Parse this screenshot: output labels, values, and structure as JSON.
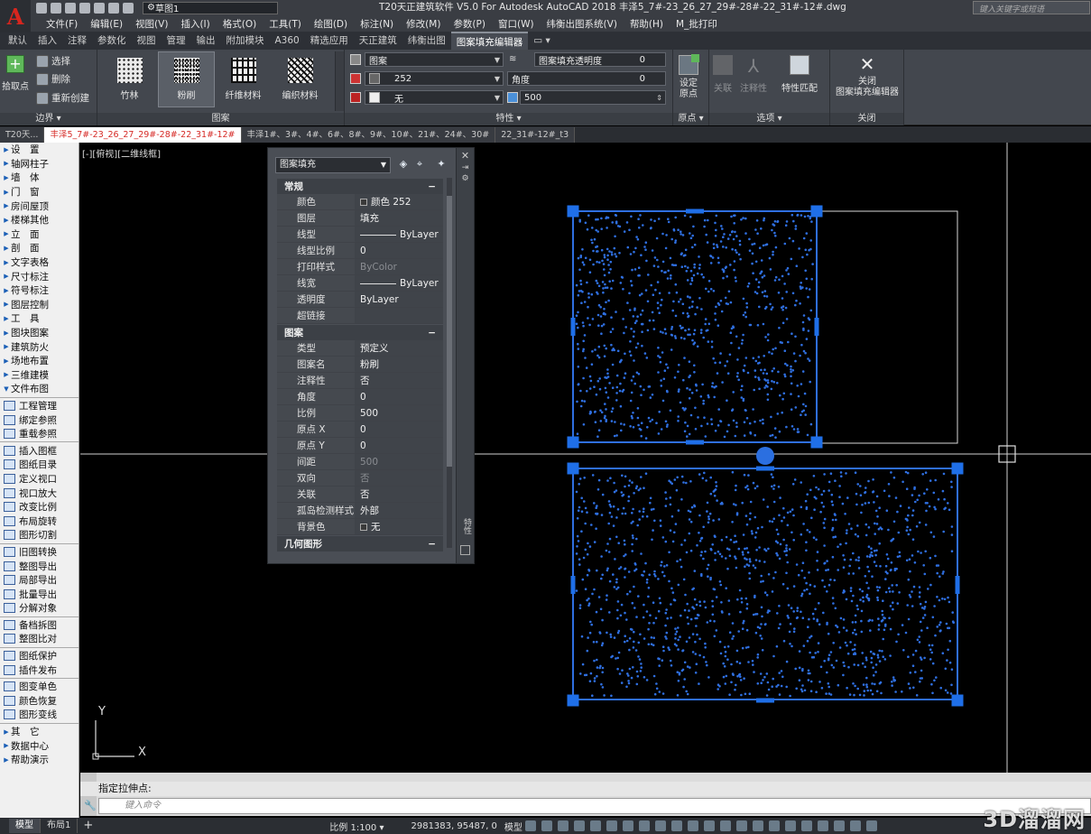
{
  "app": {
    "logo": "A",
    "title": "T20天正建筑软件 V5.0 For Autodesk AutoCAD 2018    丰泽5_7#-23_26_27_29#-28#-22_31#-12#.dwg",
    "workspace": "草图1",
    "search_placeholder": "键入关键字或短语"
  },
  "menubar": [
    "文件(F)",
    "编辑(E)",
    "视图(V)",
    "插入(I)",
    "格式(O)",
    "工具(T)",
    "绘图(D)",
    "标注(N)",
    "修改(M)",
    "参数(P)",
    "窗口(W)",
    "纬衡出图系统(V)",
    "帮助(H)",
    "M_批打印"
  ],
  "ribbon_tabs": [
    "默认",
    "插入",
    "注释",
    "参数化",
    "视图",
    "管理",
    "输出",
    "附加模块",
    "A360",
    "精选应用",
    "天正建筑",
    "纬衡出图",
    "图案填充编辑器"
  ],
  "ribbon_active_tab": "图案填充编辑器",
  "ribbon": {
    "boundary": {
      "pick_label": "拾取点",
      "select_label": "选择",
      "delete_label": "删除",
      "recreate_label": "重新创建",
      "title": "边界 ▾"
    },
    "pattern": {
      "items": [
        "竹林",
        "粉刷",
        "纤维材料",
        "编织材料"
      ],
      "selected": "粉刷",
      "title": "图案"
    },
    "properties": {
      "type": "图案",
      "transparency_label": "图案填充透明度",
      "transparency": "0",
      "color": "252",
      "angle_label": "角度",
      "angle": "0",
      "bg": "无",
      "scale": "500",
      "title": "特性 ▾"
    },
    "origin": {
      "set_label": "设定\n原点",
      "title": "原点 ▾"
    },
    "options": {
      "assoc": "关联",
      "annot": "注释性",
      "match": "特性匹配",
      "title": "选项 ▾"
    },
    "close": {
      "label": "关闭\n图案填充编辑器",
      "title": "关闭"
    }
  },
  "doc_tabs": [
    "T20天...",
    "丰泽5_7#-23_26_27_29#-28#-22_31#-12#",
    "丰泽1#、3#、4#、6#、8#、9#、10#、21#、24#、30#",
    "22_31#-12#_t3"
  ],
  "doc_active": "丰泽5_7#-23_26_27_29#-28#-22_31#-12#",
  "left_panel": [
    {
      "label": "设　置",
      "type": "tri"
    },
    {
      "label": "轴网柱子",
      "type": "tri"
    },
    {
      "label": "墙　体",
      "type": "tri"
    },
    {
      "label": "门　窗",
      "type": "tri"
    },
    {
      "label": "房间屋顶",
      "type": "tri"
    },
    {
      "label": "楼梯其他",
      "type": "tri"
    },
    {
      "label": "立　面",
      "type": "tri"
    },
    {
      "label": "剖　面",
      "type": "tri"
    },
    {
      "label": "文字表格",
      "type": "tri"
    },
    {
      "label": "尺寸标注",
      "type": "tri"
    },
    {
      "label": "符号标注",
      "type": "tri"
    },
    {
      "label": "图层控制",
      "type": "tri"
    },
    {
      "label": "工　具",
      "type": "tri"
    },
    {
      "label": "图块图案",
      "type": "tri"
    },
    {
      "label": "建筑防火",
      "type": "tri"
    },
    {
      "label": "场地布置",
      "type": "tri"
    },
    {
      "label": "三维建模",
      "type": "tri"
    },
    {
      "label": "文件布图",
      "type": "tri-open"
    },
    {
      "label": "工程管理",
      "type": "ico"
    },
    {
      "label": "绑定参照",
      "type": "ico"
    },
    {
      "label": "重载参照",
      "type": "ico"
    },
    {
      "label": "插入图框",
      "type": "ico"
    },
    {
      "label": "图纸目录",
      "type": "ico"
    },
    {
      "label": "定义视口",
      "type": "ico"
    },
    {
      "label": "视口放大",
      "type": "ico"
    },
    {
      "label": "改变比例",
      "type": "ico"
    },
    {
      "label": "布局旋转",
      "type": "ico"
    },
    {
      "label": "图形切割",
      "type": "ico"
    },
    {
      "label": "旧图转换",
      "type": "ico"
    },
    {
      "label": "整图导出",
      "type": "ico"
    },
    {
      "label": "局部导出",
      "type": "ico"
    },
    {
      "label": "批量导出",
      "type": "ico"
    },
    {
      "label": "分解对象",
      "type": "ico"
    },
    {
      "label": "备档拆图",
      "type": "ico"
    },
    {
      "label": "整图比对",
      "type": "ico"
    },
    {
      "label": "图纸保护",
      "type": "ico"
    },
    {
      "label": "插件发布",
      "type": "ico"
    },
    {
      "label": "图变单色",
      "type": "ico"
    },
    {
      "label": "颜色恢复",
      "type": "ico"
    },
    {
      "label": "图形变线",
      "type": "ico"
    },
    {
      "label": "其　它",
      "type": "tri"
    },
    {
      "label": "数据中心",
      "type": "tri"
    },
    {
      "label": "帮助演示",
      "type": "tri"
    }
  ],
  "viewport_label": "[-][俯视][二维线框]",
  "props_palette": {
    "object_type": "图案填充",
    "sections": [
      {
        "name": "常规",
        "rows": [
          {
            "k": "颜色",
            "v": "颜色 252",
            "sw": true
          },
          {
            "k": "图层",
            "v": "填充"
          },
          {
            "k": "线型",
            "v": "ByLayer",
            "lt": true
          },
          {
            "k": "线型比例",
            "v": "0"
          },
          {
            "k": "打印样式",
            "v": "ByColor",
            "dis": true
          },
          {
            "k": "线宽",
            "v": "ByLayer",
            "lt": true
          },
          {
            "k": "透明度",
            "v": "ByLayer"
          },
          {
            "k": "超链接",
            "v": ""
          }
        ]
      },
      {
        "name": "图案",
        "rows": [
          {
            "k": "类型",
            "v": "预定义"
          },
          {
            "k": "图案名",
            "v": "粉刷"
          },
          {
            "k": "注释性",
            "v": "否"
          },
          {
            "k": "角度",
            "v": "0"
          },
          {
            "k": "比例",
            "v": "500"
          },
          {
            "k": "原点 X",
            "v": "0"
          },
          {
            "k": "原点 Y",
            "v": "0"
          },
          {
            "k": "间距",
            "v": "500",
            "dis": true
          },
          {
            "k": "双向",
            "v": "否",
            "dis": true
          },
          {
            "k": "关联",
            "v": "否"
          },
          {
            "k": "孤岛检测样式",
            "v": "外部"
          },
          {
            "k": "背景色",
            "v": "无",
            "sw": true
          }
        ]
      },
      {
        "name": "几何图形",
        "rows": []
      }
    ],
    "side_label": "特性"
  },
  "command": {
    "history": "指定拉伸点:",
    "placeholder": "键入命令"
  },
  "statusbar": {
    "tabs": [
      "模型",
      "布局1"
    ],
    "scale": "比例 1:100 ▾",
    "coords": "2981383, 95487, 0",
    "mode": "模型"
  },
  "watermark": "3D溜溜网",
  "ucs": {
    "x": "X",
    "y": "Y"
  },
  "colors": {
    "hatch": "#2f6fe0",
    "grip": "#1f6fe8",
    "accent": "#d62a26"
  }
}
